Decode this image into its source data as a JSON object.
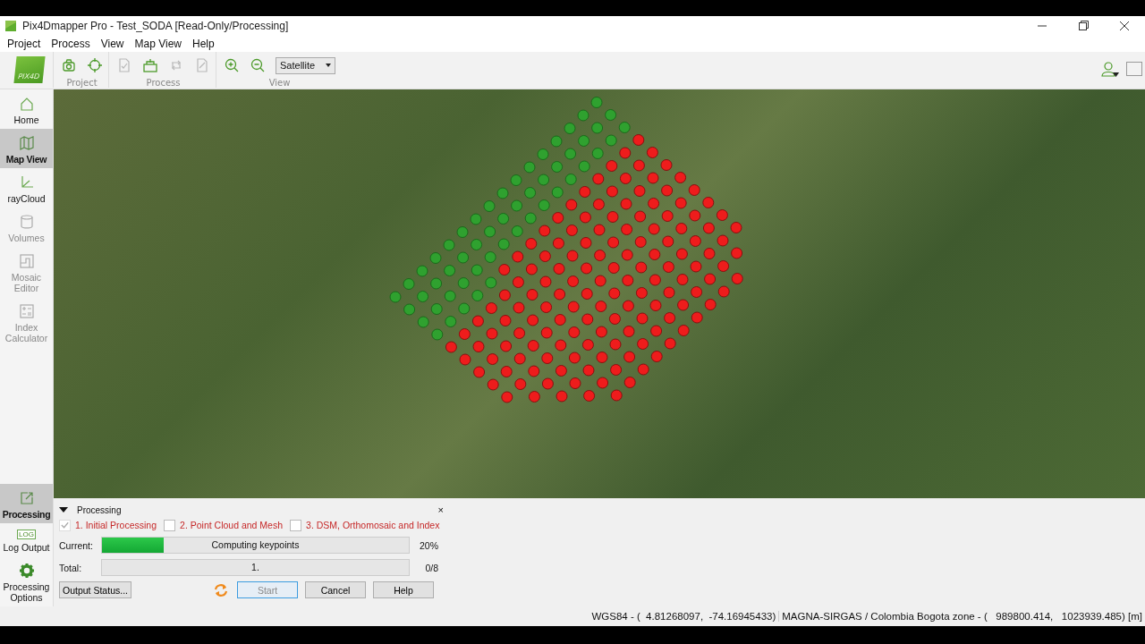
{
  "window": {
    "title": "Pix4Dmapper Pro - Test_SODA [Read-Only/Processing]"
  },
  "menu": [
    "Project",
    "Process",
    "View",
    "Map View",
    "Help"
  ],
  "toolbar": {
    "logo_text": "PIX4D",
    "groups": [
      {
        "label": "Project",
        "items": [
          {
            "kind": "camera",
            "disabled": false
          },
          {
            "kind": "target",
            "disabled": false
          }
        ]
      },
      {
        "label": "Process",
        "items": [
          {
            "kind": "check-doc",
            "disabled": true
          },
          {
            "kind": "open-box",
            "disabled": false
          },
          {
            "kind": "rotate",
            "disabled": true
          },
          {
            "kind": "edit-doc",
            "disabled": true
          }
        ]
      },
      {
        "label": "View",
        "items": [
          {
            "kind": "zoom-in",
            "disabled": false
          },
          {
            "kind": "zoom-out",
            "disabled": false
          }
        ],
        "dropdown": "Satellite"
      }
    ]
  },
  "sidebar": {
    "items": [
      {
        "label": "Home",
        "selected": false,
        "disabled": false
      },
      {
        "label": "Map View",
        "selected": true,
        "disabled": false
      },
      {
        "label": "rayCloud",
        "selected": false,
        "disabled": false
      },
      {
        "label": "Volumes",
        "selected": false,
        "disabled": true
      },
      {
        "label": "Mosaic Editor",
        "selected": false,
        "disabled": true
      },
      {
        "label": "Index Calculator",
        "selected": false,
        "disabled": true
      }
    ],
    "bottom_items": [
      {
        "label": "Processing",
        "selected": true
      },
      {
        "label": "Log Output",
        "icon_text": "LOG",
        "selected": false
      },
      {
        "label": "Processing Options",
        "selected": false
      }
    ]
  },
  "processing": {
    "title": "Processing",
    "close": "×",
    "steps": [
      {
        "label": "1. Initial Processing",
        "checked": true
      },
      {
        "label": "2. Point Cloud and Mesh",
        "checked": false
      },
      {
        "label": "3. DSM, Orthomosaic and Index",
        "checked": false
      }
    ],
    "bars": [
      {
        "label": "Current:",
        "text": "Computing keypoints",
        "level": 0.2,
        "reading": "20%"
      },
      {
        "label": "Total:",
        "text": "1.",
        "level": 0,
        "reading": "0/8"
      }
    ],
    "buttons": [
      {
        "label": "Output Status...",
        "disabled": false
      },
      {
        "label": "Start",
        "disabled": true
      },
      {
        "label": "Cancel",
        "disabled": false
      },
      {
        "label": "Help",
        "disabled": false
      }
    ]
  },
  "status_bar": [
    "WGS84 - (  4.81268097,  -74.16945433)",
    "MAGNA-SIRGAS / Colombia Bogota zone - (   989800.414,   1023939.485) [m]"
  ]
}
